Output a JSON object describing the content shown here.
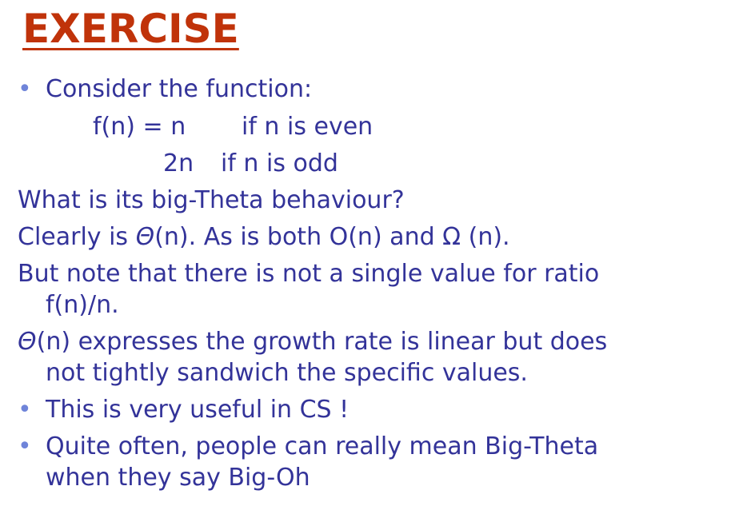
{
  "title": "EXERCISE",
  "bullets": {
    "b1": "Consider the function:",
    "b2": "This is very useful in CS !",
    "b3_line1": "Quite often, people can really mean Big-Theta",
    "b3_line2": "when they say Big-Oh"
  },
  "function_def": {
    "row1_lhs": "f(n) = n",
    "row1_cond": "if n is even",
    "row2_lhs": "2n",
    "row2_cond": "if n is odd"
  },
  "text": {
    "question": "What is its big-Theta behaviour?",
    "clearly_theta": "Θ",
    "clearly_rest": "(n).  As is both O(n) and Ω (n).",
    "clearly_prefix": "Clearly is ",
    "ratio_line1": "But note that there is not a single value for ratio",
    "ratio_line2": "f(n)/n.",
    "growth_theta": "Θ",
    "growth_line1_rest": "(n) expresses the growth rate is linear but does",
    "growth_line2": "not tightly sandwich the specific values."
  },
  "colors": {
    "title": "#c0330a",
    "body_text": "#333399",
    "bullet": "#6f84d9"
  }
}
